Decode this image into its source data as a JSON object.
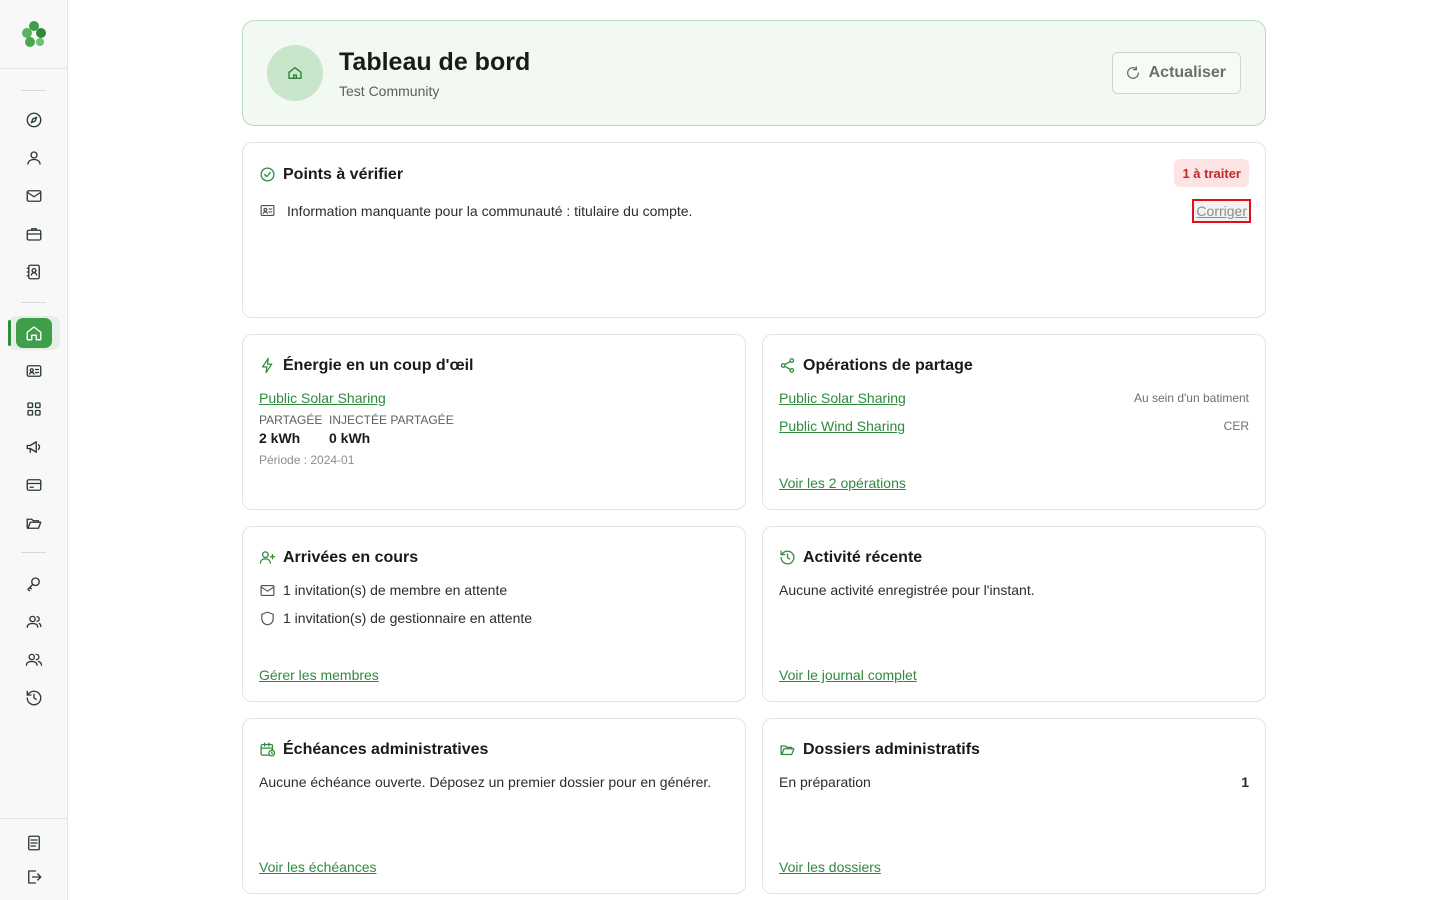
{
  "sidebar": {
    "logo": "clover-logo",
    "nav_top": [
      "compass-icon",
      "user-icon",
      "mail-icon",
      "briefcase-icon",
      "contact-book-icon"
    ],
    "nav_mid": [
      "home-icon",
      "id-card-icon",
      "grid-icon",
      "megaphone-icon",
      "credit-card-icon",
      "folder-open-icon"
    ],
    "nav_low": [
      "key-icon",
      "users-icon",
      "users-alt-icon",
      "history-icon"
    ],
    "nav_bottom": [
      "document-icon",
      "logout-icon"
    ]
  },
  "header": {
    "title": "Tableau de bord",
    "subtitle": "Test Community",
    "refresh_label": "Actualiser"
  },
  "checks": {
    "title": "Points à vérifier",
    "badge": "1 à traiter",
    "items": [
      {
        "text": "Information manquante pour la communauté : titulaire du compte.",
        "action": "Corriger"
      }
    ]
  },
  "energy": {
    "title": "Énergie en un coup d'œil",
    "operation_link": "Public Solar Sharing",
    "shared_label": "PARTAGÉE",
    "shared_value": "2 kWh",
    "injected_label": "INJECTÉE PARTAGÉE",
    "injected_value": "0 kWh",
    "period": "Période : 2024-01"
  },
  "operations": {
    "title": "Opérations de partage",
    "items": [
      {
        "name": "Public Solar Sharing",
        "type": "Au sein d'un batiment"
      },
      {
        "name": "Public Wind Sharing",
        "type": "CER"
      }
    ],
    "more_link": "Voir les 2 opérations"
  },
  "arrivals": {
    "title": "Arrivées en cours",
    "member_invites": "1 invitation(s) de membre en attente",
    "manager_invites": "1 invitation(s) de gestionnaire en attente",
    "manage_link": "Gérer les membres"
  },
  "activity": {
    "title": "Activité récente",
    "empty": "Aucune activité enregistrée pour l'instant.",
    "journal_link": "Voir le journal complet"
  },
  "deadlines": {
    "title": "Échéances administratives",
    "empty": "Aucune échéance ouverte. Déposez un premier dossier pour en générer.",
    "link": "Voir les échéances"
  },
  "files": {
    "title": "Dossiers administratifs",
    "status_label": "En préparation",
    "status_count": "1",
    "link": "Voir les dossiers"
  },
  "colors": {
    "accent": "#3f9e4a",
    "accent_dark": "#2f8a3c",
    "badge_bg": "#fde3e3",
    "badge_text": "#c02a2a",
    "header_bg": "#f2f9f2"
  }
}
